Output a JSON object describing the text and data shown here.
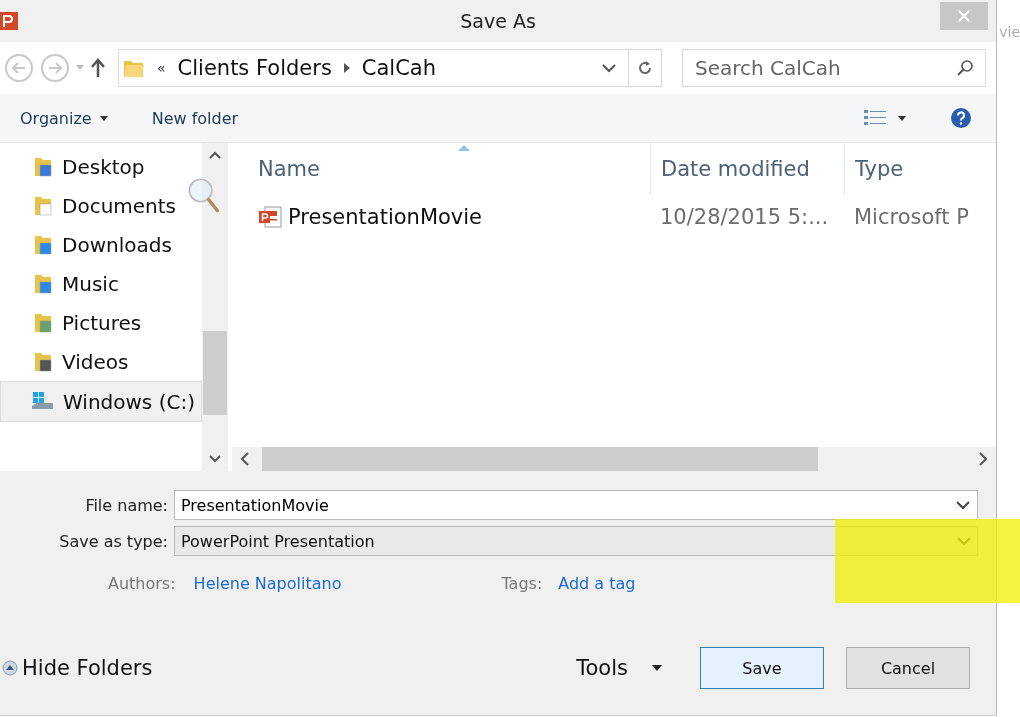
{
  "window": {
    "title": "Save As"
  },
  "background_text": "vie",
  "address_bar": {
    "overflow": "«",
    "crumbs": [
      "Clients Folders",
      "CalCah"
    ]
  },
  "search": {
    "placeholder": "Search CalCah"
  },
  "toolbar": {
    "organize": "Organize",
    "new_folder": "New folder"
  },
  "sidebar": {
    "items": [
      {
        "label": "Desktop",
        "kind": "desktop",
        "selected": false
      },
      {
        "label": "Documents",
        "kind": "documents",
        "selected": false
      },
      {
        "label": "Downloads",
        "kind": "downloads",
        "selected": false
      },
      {
        "label": "Music",
        "kind": "music",
        "selected": false
      },
      {
        "label": "Pictures",
        "kind": "pictures",
        "selected": false
      },
      {
        "label": "Videos",
        "kind": "videos",
        "selected": false
      },
      {
        "label": "Windows (C:)",
        "kind": "drive",
        "selected": true
      }
    ]
  },
  "table": {
    "columns": [
      "Name",
      "Date modified",
      "Type"
    ],
    "rows": [
      {
        "name": "PresentationMovie",
        "date": "10/28/2015 5:...",
        "type": "Microsoft P",
        "selected": false
      }
    ]
  },
  "form": {
    "file_name_label": "File name:",
    "file_name": "PresentationMovie",
    "type_label": "Save as type:",
    "type": "PowerPoint Presentation",
    "authors_label": "Authors:",
    "authors": "Helene Napolitano",
    "tags_label": "Tags:",
    "tags": "Add a tag"
  },
  "footer": {
    "hide_folders": "Hide Folders",
    "tools": "Tools",
    "save": "Save",
    "cancel": "Cancel"
  }
}
